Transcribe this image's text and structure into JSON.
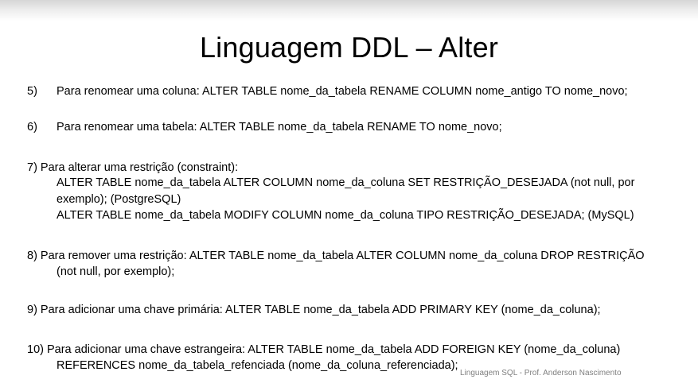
{
  "title": "Linguagem DDL – Alter",
  "items": [
    {
      "number": "5)",
      "text": "Para renomear uma coluna: ALTER TABLE nome_da_tabela RENAME COLUMN nome_antigo TO nome_novo;"
    },
    {
      "number": "6)",
      "text": "Para renomear uma tabela: ALTER TABLE nome_da_tabela RENAME TO nome_novo;"
    },
    {
      "heading": "7) Para alterar uma restrição (constraint):",
      "lines": [
        "ALTER TABLE nome_da_tabela ALTER COLUMN nome_da_coluna SET RESTRIÇÃO_DESEJADA (not null, por",
        "exemplo); (PostgreSQL)",
        "ALTER TABLE nome_da_tabela MODIFY COLUMN nome_da_coluna TIPO  RESTRIÇÃO_DESEJADA; (MySQL)"
      ]
    },
    {
      "heading": "8) Para remover uma restrição: ALTER TABLE nome_da_tabela ALTER COLUMN nome_da_coluna DROP RESTRIÇÃO",
      "lines": [
        "(not null, por exemplo);"
      ]
    },
    {
      "heading": "9) Para adicionar uma chave primária: ALTER TABLE nome_da_tabela ADD PRIMARY KEY (nome_da_coluna);"
    },
    {
      "heading": "10) Para adicionar uma chave estrangeira: ALTER TABLE nome_da_tabela ADD FOREIGN KEY (nome_da_coluna)",
      "lines": [
        "REFERENCES nome_da_tabela_refenciada (nome_da_coluna_referenciada);"
      ]
    }
  ],
  "footer": "Linguagem SQL - Prof. Anderson Nascimento"
}
